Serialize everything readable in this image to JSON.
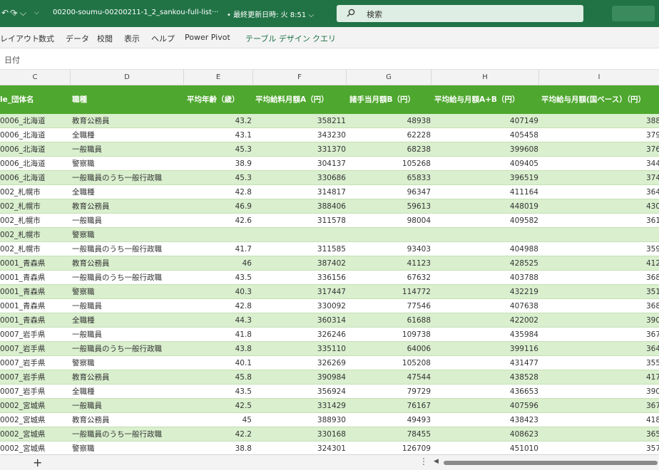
{
  "titlebar": {
    "undo_icon": "undo-icon",
    "redo_icon": "redo-icon",
    "filename": "00200-soumu-00200211-1_2_sankou-full-list···",
    "saved": "• 最終更新日時: 火 8:51 ⌵",
    "search_placeholder": "検索"
  },
  "ribbon": {
    "tabs": [
      "レイアウト",
      "数式",
      "データ",
      "校閲",
      "表示",
      "ヘルプ",
      "Power Pivot",
      "テーブル デザイン",
      "クエリ"
    ]
  },
  "formula_bar": {
    "content": "日付"
  },
  "column_letters": [
    "C",
    "D",
    "E",
    "F",
    "G",
    "H",
    "I"
  ],
  "headers": {
    "c": "le_団体名",
    "d": "職種",
    "e": "平均年齢（歳）",
    "f": "平均給料月額A（円）",
    "g": "諸手当月額B（円）",
    "h": "平均給与月額A+B（円）",
    "i": "平均給与月額(国ベース）（円）"
  },
  "rows": [
    {
      "c": "0006_北海道",
      "d": "教育公務員",
      "e": "43.2",
      "f": "358211",
      "g": "48938",
      "h": "407149",
      "i": "388"
    },
    {
      "c": "0006_北海道",
      "d": "全職種",
      "e": "43.1",
      "f": "343230",
      "g": "62228",
      "h": "405458",
      "i": "379"
    },
    {
      "c": "0006_北海道",
      "d": "一般職員",
      "e": "45.3",
      "f": "331370",
      "g": "68238",
      "h": "399608",
      "i": "376"
    },
    {
      "c": "0006_北海道",
      "d": "警察職",
      "e": "38.9",
      "f": "304137",
      "g": "105268",
      "h": "409405",
      "i": "344"
    },
    {
      "c": "0006_北海道",
      "d": "一般職員のうち一般行政職",
      "e": "45.3",
      "f": "330686",
      "g": "65833",
      "h": "396519",
      "i": "374"
    },
    {
      "c": "002_札幌市",
      "d": "全職種",
      "e": "42.8",
      "f": "314817",
      "g": "96347",
      "h": "411164",
      "i": "364"
    },
    {
      "c": "002_札幌市",
      "d": "教育公務員",
      "e": "46.9",
      "f": "388406",
      "g": "59613",
      "h": "448019",
      "i": "430"
    },
    {
      "c": "002_札幌市",
      "d": "一般職員",
      "e": "42.6",
      "f": "311578",
      "g": "98004",
      "h": "409582",
      "i": "361"
    },
    {
      "c": "002_札幌市",
      "d": "警察職",
      "e": "",
      "f": "",
      "g": "",
      "h": "",
      "i": ""
    },
    {
      "c": "002_札幌市",
      "d": "一般職員のうち一般行政職",
      "e": "41.7",
      "f": "311585",
      "g": "93403",
      "h": "404988",
      "i": "359"
    },
    {
      "c": "0001_青森県",
      "d": "教育公務員",
      "e": "46",
      "f": "387402",
      "g": "41123",
      "h": "428525",
      "i": "412"
    },
    {
      "c": "0001_青森県",
      "d": "一般職員のうち一般行政職",
      "e": "43.5",
      "f": "336156",
      "g": "67632",
      "h": "403788",
      "i": "368"
    },
    {
      "c": "0001_青森県",
      "d": "警察職",
      "e": "40.3",
      "f": "317447",
      "g": "114772",
      "h": "432219",
      "i": "351"
    },
    {
      "c": "0001_青森県",
      "d": "一般職員",
      "e": "42.8",
      "f": "330092",
      "g": "77546",
      "h": "407638",
      "i": "368"
    },
    {
      "c": "0001_青森県",
      "d": "全職種",
      "e": "44.3",
      "f": "360314",
      "g": "61688",
      "h": "422002",
      "i": "390"
    },
    {
      "c": "0007_岩手県",
      "d": "一般職員",
      "e": "41.8",
      "f": "326246",
      "g": "109738",
      "h": "435984",
      "i": "367"
    },
    {
      "c": "0007_岩手県",
      "d": "一般職員のうち一般行政職",
      "e": "43.8",
      "f": "335110",
      "g": "64006",
      "h": "399116",
      "i": "364"
    },
    {
      "c": "0007_岩手県",
      "d": "警察職",
      "e": "40.1",
      "f": "326269",
      "g": "105208",
      "h": "431477",
      "i": "355"
    },
    {
      "c": "0007_岩手県",
      "d": "教育公務員",
      "e": "45.8",
      "f": "390984",
      "g": "47544",
      "h": "438528",
      "i": "417"
    },
    {
      "c": "0007_岩手県",
      "d": "全職種",
      "e": "43.5",
      "f": "356924",
      "g": "79729",
      "h": "436653",
      "i": "390"
    },
    {
      "c": "0002_宮城県",
      "d": "一般職員",
      "e": "42.5",
      "f": "331429",
      "g": "76167",
      "h": "407596",
      "i": "367"
    },
    {
      "c": "0002_宮城県",
      "d": "教育公務員",
      "e": "45",
      "f": "388930",
      "g": "49493",
      "h": "438423",
      "i": "418"
    },
    {
      "c": "0002_宮城県",
      "d": "一般職員のうち一般行政職",
      "e": "42.2",
      "f": "330168",
      "g": "78455",
      "h": "408623",
      "i": "365"
    },
    {
      "c": "0002_宮城県",
      "d": "警察職",
      "e": "38.8",
      "f": "324301",
      "g": "126709",
      "h": "451010",
      "i": "357"
    }
  ],
  "bottombar": {
    "add_label": "+",
    "more_label": "⋮",
    "scroll_left_label": "◀"
  }
}
